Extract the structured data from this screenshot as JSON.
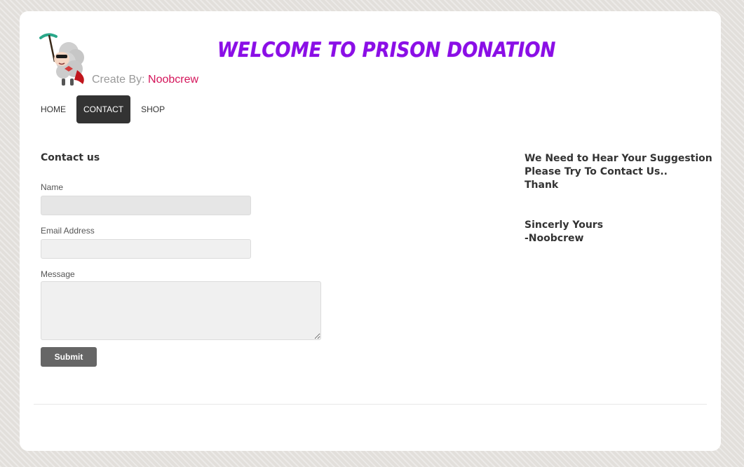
{
  "header": {
    "title": "WELCOME TO PRISON DONATION",
    "creator_prefix": "Create By: ",
    "creator_name": "Noobcrew",
    "logo_icon": "sheep-mascot-icon"
  },
  "nav": {
    "items": [
      {
        "label": "HOME",
        "active": false
      },
      {
        "label": "CONTACT",
        "active": true
      },
      {
        "label": "SHOP",
        "active": false
      }
    ]
  },
  "contact_form": {
    "heading": "Contact us",
    "name_label": "Name",
    "name_value": "",
    "email_label": "Email Address",
    "email_value": "",
    "message_label": "Message",
    "message_value": "",
    "submit_label": "Submit"
  },
  "sidebar": {
    "line1": "We Need to Hear Your Suggestion",
    "line2": "Please Try To Contact Us..",
    "line3": "Thank",
    "line4": "Sincerly Yours",
    "line5": "-Noobcrew"
  },
  "colors": {
    "title": "#8a0ee6",
    "creator_name": "#d4145a",
    "nav_active_bg": "#333333",
    "submit_bg": "#666666",
    "page_bg": "#e2dfdb"
  }
}
